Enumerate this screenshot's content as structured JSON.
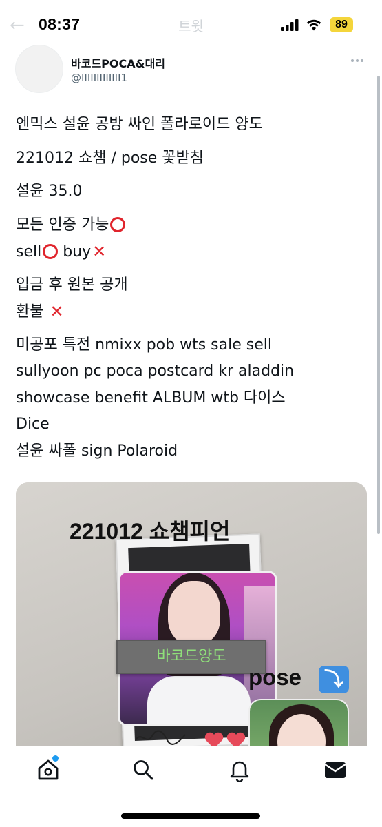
{
  "status_bar": {
    "time": "08:37",
    "battery": "89",
    "battery_color": "#f4d53b",
    "behind_title": "트윗",
    "icons": [
      "signal-icon",
      "wifi-icon"
    ]
  },
  "header": {
    "display_name": "바코드POCA&대리",
    "handle": "@IIIIIIIIIIIII1"
  },
  "tweet": {
    "lines": [
      "엔믹스 설윤 공방 싸인 폴라로이드 양도",
      "221012 쇼챔 / pose 꽃받침",
      "설윤 35.0",
      "모든 인증 가능",
      "sell",
      "buy",
      "입금 후 원본 공개",
      "환불",
      "미공포 특전 nmixx pob wts sale sell",
      "sullyoon pc poca postcard kr aladdin",
      "showcase benefit ALBUM wtb 다이스",
      "Dice",
      "설윤 싸폴 sign Polaroid"
    ]
  },
  "media": {
    "caption_date": "221012 쇼챔피언",
    "sticker": "바코드양도",
    "caption_pose": "pose",
    "arrow_glyph": "⤵"
  },
  "nav": {
    "items": [
      "home",
      "search",
      "notifications",
      "messages"
    ]
  },
  "colors": {
    "accent": "#1d9bf0",
    "mark_red": "#e0242c",
    "sticker_text": "#8fe07a"
  }
}
